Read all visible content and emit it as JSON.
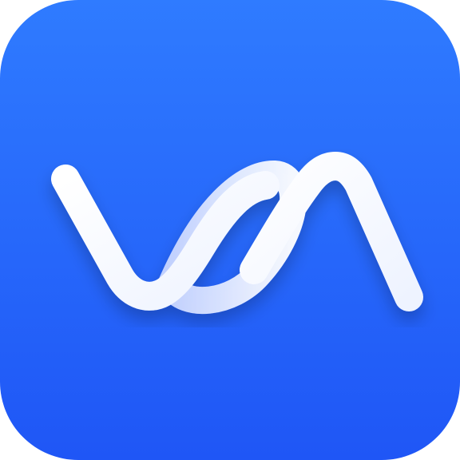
{
  "app_icon": {
    "icon": "va-wave-logo-icon",
    "colors": {
      "background_top": "#2F7BFF",
      "background_bottom": "#1F56F6",
      "stroke_front": "#FFFFFF",
      "stroke_back": "#C9D6FF"
    }
  }
}
